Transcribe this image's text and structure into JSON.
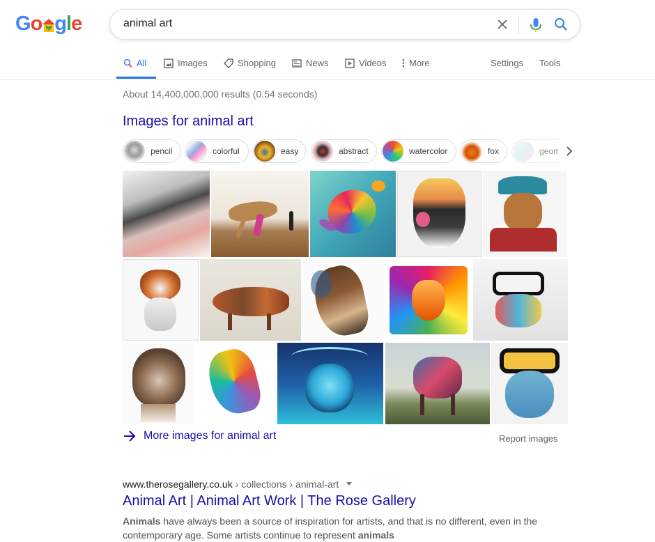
{
  "logo": {
    "letters": [
      "G",
      "o",
      "o",
      "g",
      "l",
      "e"
    ]
  },
  "search": {
    "query": "animal art"
  },
  "tabs": [
    {
      "label": "All",
      "icon": "search-icon"
    },
    {
      "label": "Images",
      "icon": "image-icon"
    },
    {
      "label": "Shopping",
      "icon": "tag-icon"
    },
    {
      "label": "News",
      "icon": "news-icon"
    },
    {
      "label": "Videos",
      "icon": "play-icon"
    },
    {
      "label": "More",
      "icon": "more-vertical-icon"
    }
  ],
  "tools": {
    "settings": "Settings",
    "tools": "Tools"
  },
  "stats": "About 14,400,000,000 results (0.54 seconds)",
  "images_section": {
    "title": "Images for animal art",
    "chips": [
      "pencil",
      "colorful",
      "easy",
      "abstract",
      "watercolor",
      "fox",
      "geom"
    ],
    "more_link": "More images for animal art",
    "report": "Report images"
  },
  "result": {
    "domain": "www.therosegallery.co.uk",
    "path": " › collections › animal-art",
    "title": "Animal Art | Animal Art Work | The Rose Gallery",
    "snippet_bold_1": "Animals",
    "snippet_text_1": " have always been a source of inspiration for artists, and that is no different, even in the",
    "snippet_text_2": "contemporary age. Some artists continue to represent ",
    "snippet_bold_2": "animals"
  },
  "colors": {
    "link": "#1a0dab",
    "accent": "#1a73e8",
    "blue": "#4285f4",
    "red": "#ea4335",
    "yellow": "#fbbc05",
    "green": "#34a853"
  }
}
